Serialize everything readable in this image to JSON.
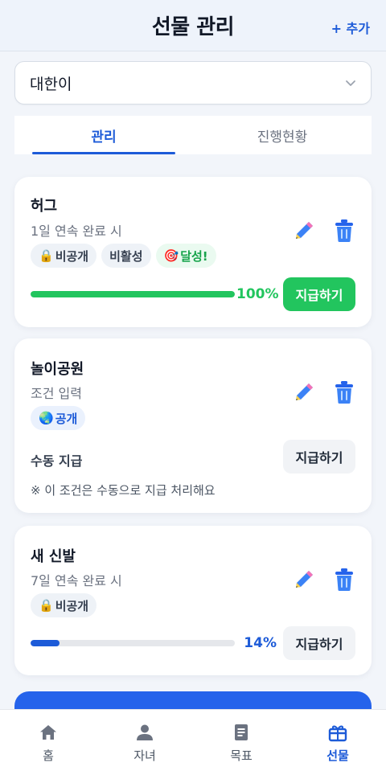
{
  "header": {
    "title": "선물 관리",
    "add_label": "+ 추가"
  },
  "child_select": {
    "value": "대한이"
  },
  "tabs": [
    {
      "label": "관리",
      "active": true
    },
    {
      "label": "진행현황",
      "active": false
    }
  ],
  "gifts": [
    {
      "name": "허그",
      "condition": "1일 연속 완료 시",
      "badges": [
        {
          "icon": "lock-icon",
          "label": "비공개"
        },
        {
          "label": "비활성"
        },
        {
          "icon": "target-icon",
          "label": "달성!"
        }
      ],
      "progress_percent": 100,
      "progress_text": "100%",
      "pay_label": "지급하기"
    },
    {
      "name": "놀이공원",
      "condition": "조건 입력",
      "badges": [
        {
          "icon": "globe-icon",
          "label": "공개"
        }
      ],
      "manual_label": "수동 지급",
      "note": "※ 이 조건은 수동으로 지급 처리해요",
      "pay_label": "지급하기"
    },
    {
      "name": "새 신발",
      "condition": "7일 연속 완료 시",
      "badges": [
        {
          "icon": "lock-icon",
          "label": "비공개"
        }
      ],
      "progress_percent": 14,
      "progress_text": "14%",
      "pay_label": "지급하기"
    }
  ],
  "bottom_nav": [
    {
      "label": "홈",
      "icon": "home-icon"
    },
    {
      "label": "자녀",
      "icon": "person-icon"
    },
    {
      "label": "목표",
      "icon": "document-icon"
    },
    {
      "label": "선물",
      "icon": "gift-icon",
      "active": true
    }
  ],
  "colors": {
    "primary": "#1d5bd8",
    "success": "#22c55e",
    "action": "#2563eb"
  }
}
